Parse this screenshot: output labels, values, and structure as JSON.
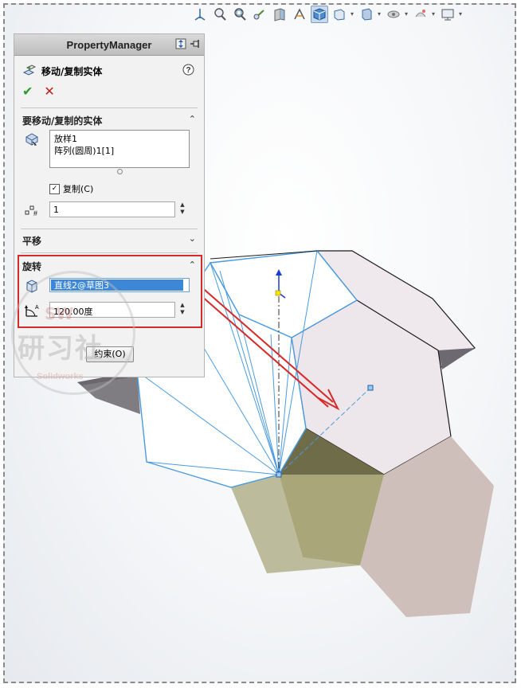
{
  "panel": {
    "header_title": "PropertyManager",
    "feature_title": "移动/复制实体",
    "ok_symbol": "✔",
    "cancel_symbol": "✕"
  },
  "bodies_group": {
    "title": "要移动/复制的实体",
    "items": [
      "放样1",
      "阵列(圆周)1[1]"
    ],
    "copy_label": "复制(C)",
    "copy_checked": true,
    "copy_count": "1"
  },
  "translate_group": {
    "title": "平移"
  },
  "rotate_group": {
    "title": "旋转",
    "axis_selection": "直线2@草图3",
    "angle_value": "120.00度"
  },
  "constraint_button": "约束(O)",
  "toolbar": {
    "icons": [
      "view-orientation-icon",
      "zoom-to-fit-icon",
      "zoom-area-icon",
      "previous-view-icon",
      "section-view-icon",
      "dynamic-annotation-icon",
      "view-cube-icon",
      "display-style-icon",
      "hide-show-icon",
      "edit-appearance-icon",
      "apply-scene-icon",
      "view-settings-icon"
    ]
  },
  "watermark": {
    "text": "研习社",
    "small_text": "SW",
    "brand": "Solidworks"
  },
  "colors": {
    "selection_blue": "#3c87d7",
    "highlight_red": "#d62b2b",
    "edge_blue": "#4a9be0"
  }
}
